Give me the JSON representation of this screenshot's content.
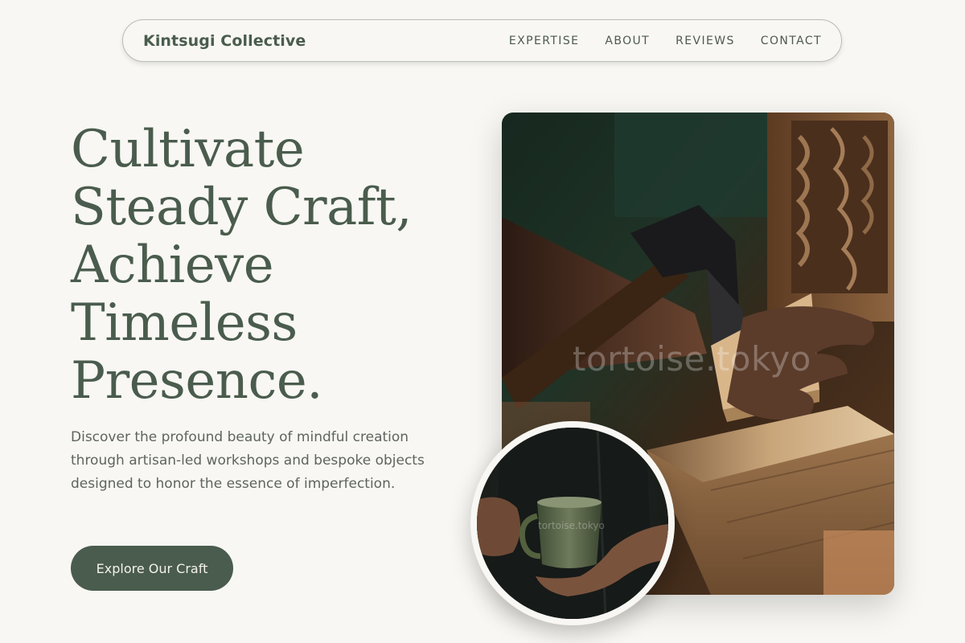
{
  "nav": {
    "brand": "Kintsugi Collective",
    "links": [
      "EXPERTISE",
      "ABOUT",
      "REVIEWS",
      "CONTACT"
    ]
  },
  "hero": {
    "headline_lines": [
      "Cultivate",
      "Steady Craft,",
      "Achieve",
      "Timeless",
      "Presence."
    ],
    "description": "Discover the profound beauty of mindful creation through artisan-led workshops and bespoke objects designed to honor the essence of imperfection.",
    "cta_label": "Explore Our Craft"
  },
  "images": {
    "main_watermark": "tortoise.tokyo",
    "circle_watermark": "tortoise.tokyo"
  },
  "colors": {
    "background": "#f8f7f3",
    "accent": "#4a5c4d",
    "body_text": "#5f645e"
  }
}
